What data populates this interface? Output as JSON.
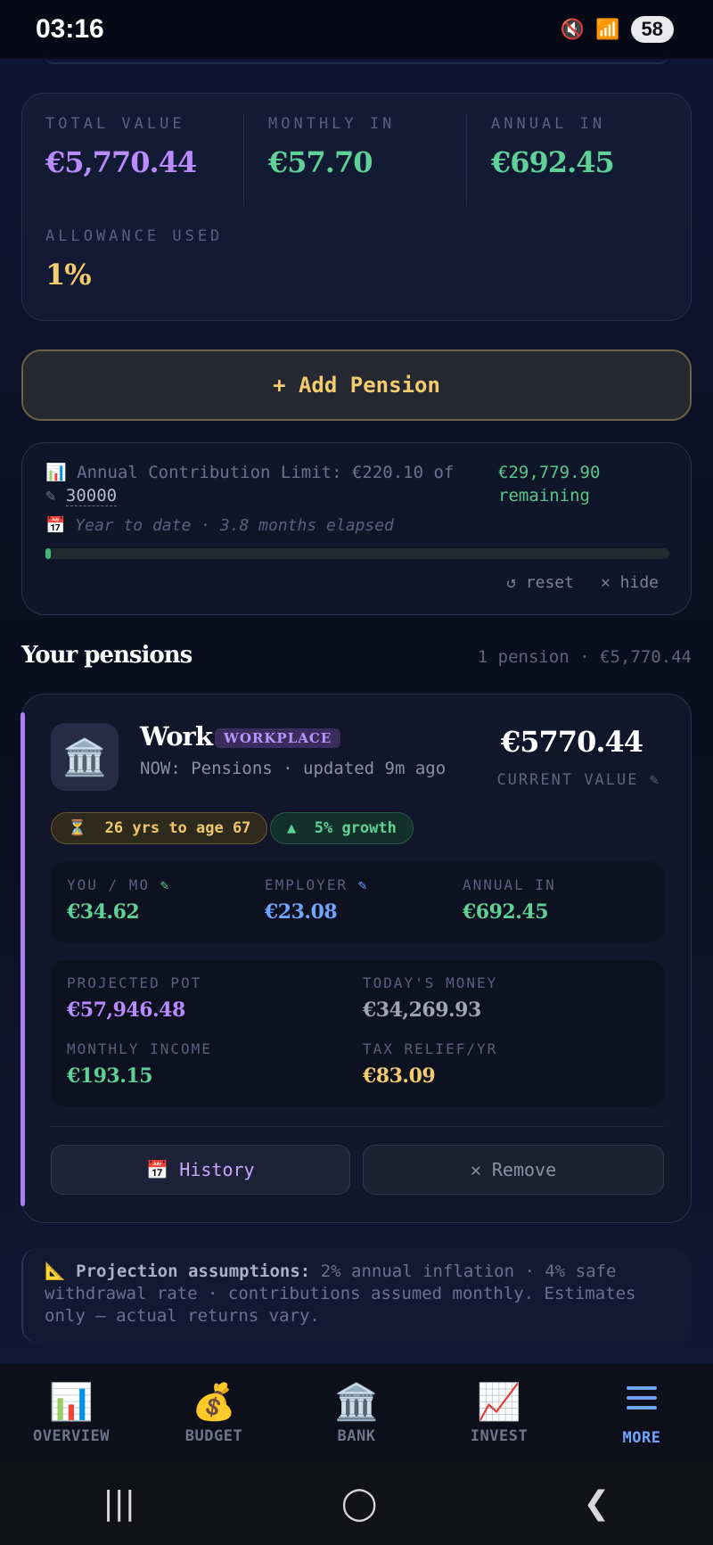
{
  "status": {
    "time": "03:16",
    "battery": "58"
  },
  "summary": {
    "total_label": "TOTAL VALUE",
    "total_value": "€5,770.44",
    "monthly_label": "MONTHLY IN",
    "monthly_value": "€57.70",
    "annual_label": "ANNUAL IN",
    "annual_value": "€692.45",
    "allowance_label": "ALLOWANCE USED",
    "allowance_value": "1%"
  },
  "add_pension_label": "+ Add Pension",
  "limit": {
    "text": "Annual Contribution Limit: €220.10 of",
    "limit_value": "30000",
    "remaining": "€29,779.90 remaining",
    "ytd": "Year to date · 3.8 months elapsed",
    "progress_fraction": 0.0073,
    "reset_label": "reset",
    "hide_label": "hide"
  },
  "pensions_section": {
    "title": "Your pensions",
    "meta": "1 pension · €5,770.44"
  },
  "pension": {
    "name": "Work",
    "badge": "WORKPLACE",
    "subtitle": "NOW: Pensions · updated 9m ago",
    "value": "€5770.44",
    "value_label": "CURRENT VALUE",
    "age_chip": "26 yrs to age 67",
    "growth_chip": "5% growth",
    "you_label": "YOU / MO",
    "you_value": "€34.62",
    "employer_label": "EMPLOYER",
    "employer_value": "€23.08",
    "annual_label": "ANNUAL IN",
    "annual_value": "€692.45",
    "projected_label": "PROJECTED POT",
    "projected_value": "€57,946.48",
    "todays_label": "TODAY'S MONEY",
    "todays_value": "€34,269.93",
    "income_label": "MONTHLY INCOME",
    "income_value": "€193.15",
    "relief_label": "TAX RELIEF/YR",
    "relief_value": "€83.09",
    "history_label": "History",
    "remove_label": "Remove"
  },
  "assumptions": {
    "title": "Projection assumptions:",
    "text": "2% annual inflation · 4% safe withdrawal rate · contributions assumed monthly. Estimates only — actual returns vary."
  },
  "nav": [
    {
      "label": "OVERVIEW",
      "icon": "bar-chart-icon"
    },
    {
      "label": "BUDGET",
      "icon": "money-bag-icon"
    },
    {
      "label": "BANK",
      "icon": "bank-icon"
    },
    {
      "label": "INVEST",
      "icon": "trend-chart-icon"
    },
    {
      "label": "MORE",
      "icon": "menu-icon"
    }
  ],
  "colors": {
    "purple": "#b98bff",
    "green": "#5fd096",
    "blue": "#6fa4ff",
    "gold": "#f2cc6e"
  }
}
